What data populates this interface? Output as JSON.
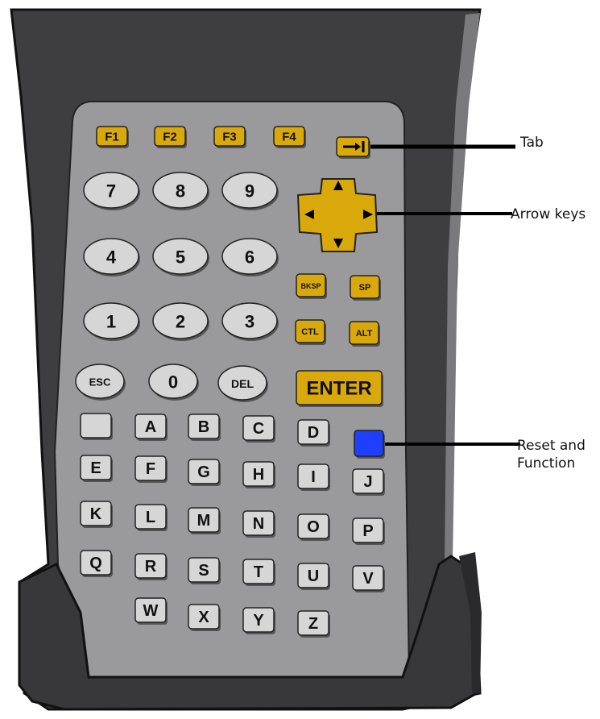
{
  "callouts": {
    "tab": "Tab",
    "arrow_keys": "Arrow keys",
    "reset_line1": "Reset and",
    "reset_line2": "Function"
  },
  "keys": {
    "function_keys": [
      "F1",
      "F2",
      "F3",
      "F4"
    ],
    "number_keys": [
      "7",
      "8",
      "9",
      "4",
      "5",
      "6",
      "1",
      "2",
      "3"
    ],
    "bottom_round_keys": [
      "ESC",
      "0",
      "DEL"
    ],
    "small_yellow_keys": [
      "BKSP",
      "SP",
      "CTL",
      "ALT"
    ],
    "enter": "ENTER",
    "letters": [
      "A",
      "B",
      "C",
      "D",
      "E",
      "F",
      "G",
      "H",
      "I",
      "J",
      "K",
      "L",
      "M",
      "N",
      "O",
      "P",
      "Q",
      "R",
      "S",
      "T",
      "U",
      "V",
      "W",
      "X",
      "Y",
      "Z"
    ]
  },
  "colors": {
    "device_body": "#3e3e40",
    "keypad_panel": "#9a9a9c",
    "yellow_key": "#d9a90b",
    "grey_key": "#d6d6d6",
    "function_key_blue": "#1f3fff"
  }
}
